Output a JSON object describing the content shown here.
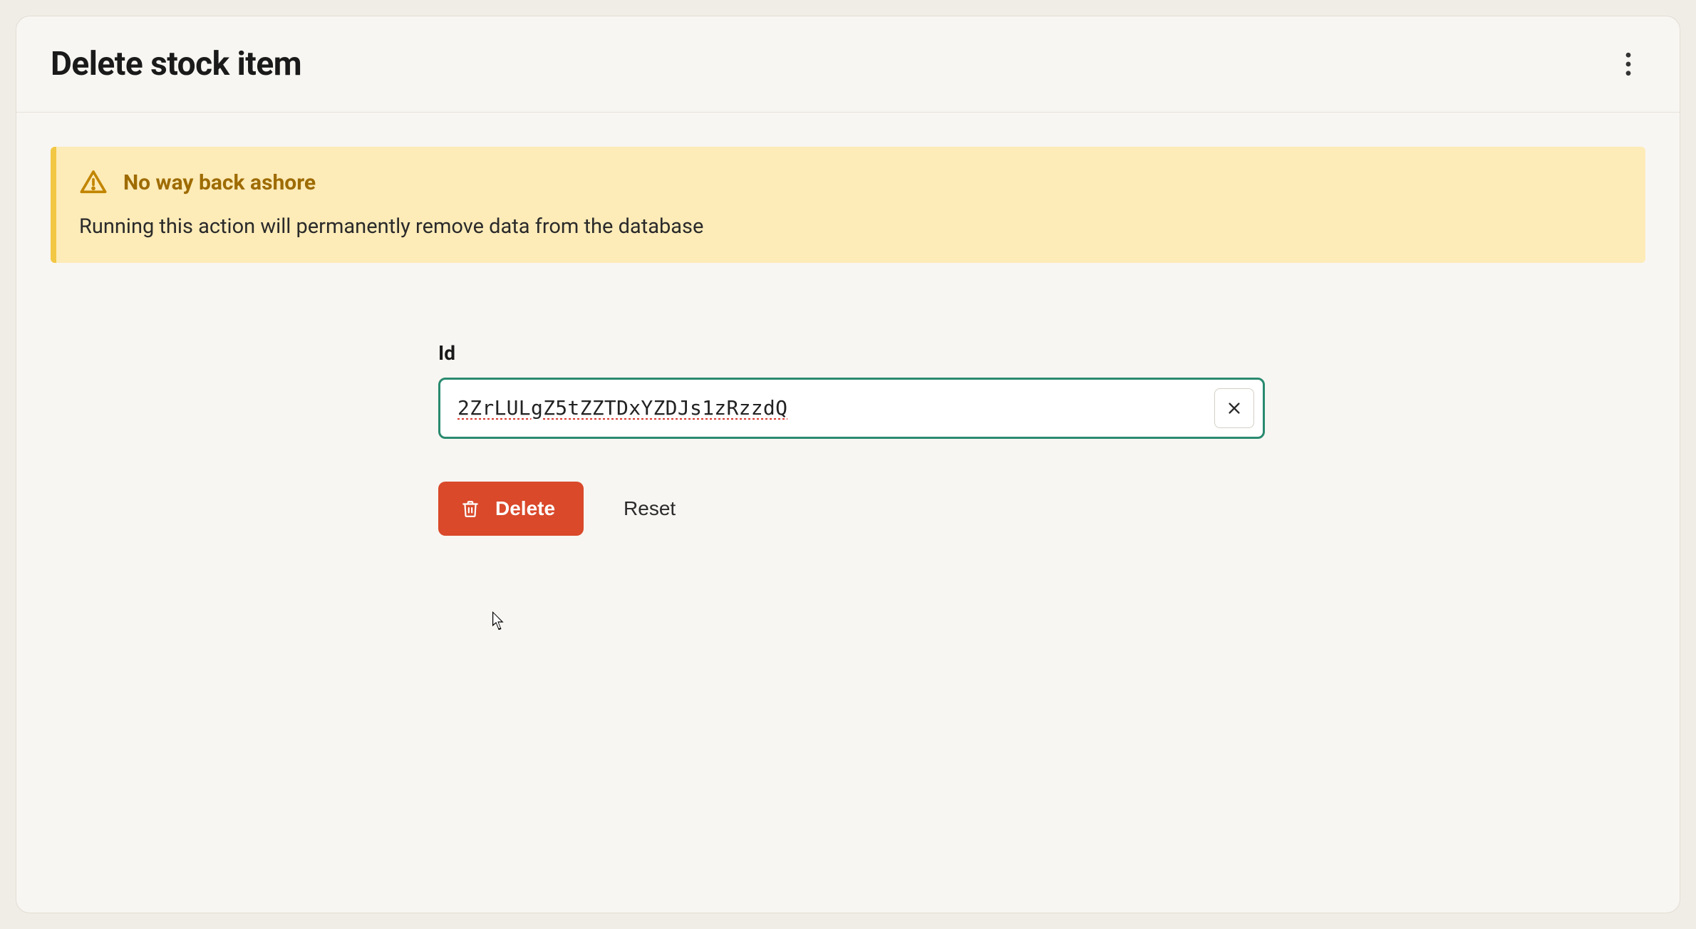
{
  "header": {
    "title": "Delete stock item"
  },
  "alert": {
    "title": "No way back ashore",
    "body": "Running this action will permanently remove data from the database"
  },
  "form": {
    "id_label": "Id",
    "id_value": "2ZrLULgZ5tZZTDxYZDJs1zRzzdQ"
  },
  "buttons": {
    "delete_label": "Delete",
    "reset_label": "Reset"
  },
  "colors": {
    "danger": "#d9492a",
    "focus_border": "#2a8a6f",
    "alert_bg": "#fdebb8",
    "alert_border": "#f2c744",
    "alert_title": "#9e6b00"
  }
}
